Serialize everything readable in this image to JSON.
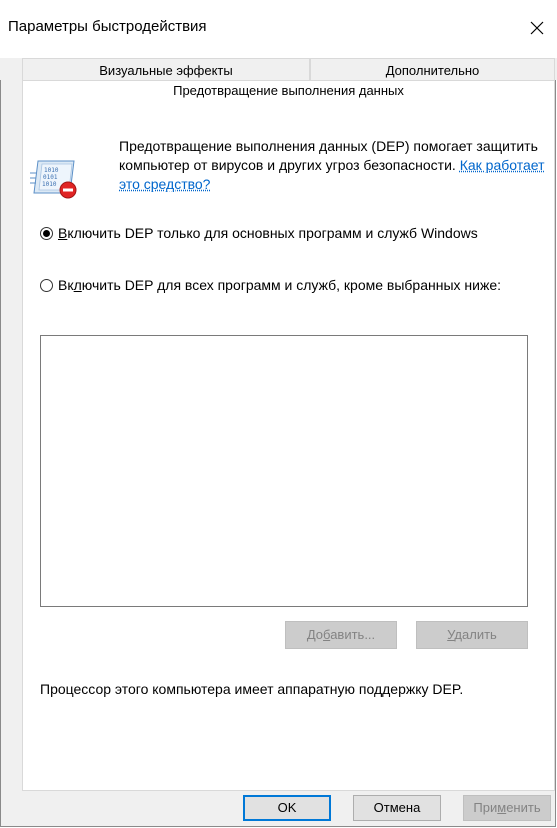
{
  "window": {
    "title": "Параметры быстродействия",
    "close_glyph": "✕"
  },
  "tabs": [
    {
      "label": "Визуальные эффекты"
    },
    {
      "label": "Дополнительно"
    },
    {
      "label": "Предотвращение выполнения данных",
      "active": true
    }
  ],
  "intro": {
    "text": "Предотвращение выполнения данных (DEP) помогает защитить компьютер от вирусов и других угроз безопасности. ",
    "link": "Как работает это средство?",
    "icon": "dep-shield-icon"
  },
  "options": [
    {
      "mnemonic": "В",
      "rest": "ключить DEP только для основных программ и служб Windows",
      "selected": true
    },
    {
      "pre": "Вк",
      "mnemonic": "л",
      "rest": "ючить DEP для всех программ и служб, кроме выбранных ниже:",
      "selected": false
    }
  ],
  "program_list": [],
  "buttons": {
    "add_pre": "До",
    "add_mn": "б",
    "add_post": "авить...",
    "remove_mn": "У",
    "remove_post": "далить",
    "ok": "OK",
    "cancel": "Отмена",
    "apply_pre": "При",
    "apply_mn": "м",
    "apply_post": "енить"
  },
  "status": "Процессор этого компьютера имеет аппаратную поддержку DEP.",
  "colors": {
    "link": "#0066cc",
    "accent": "#0078d7",
    "disabled": "#cccccc"
  }
}
